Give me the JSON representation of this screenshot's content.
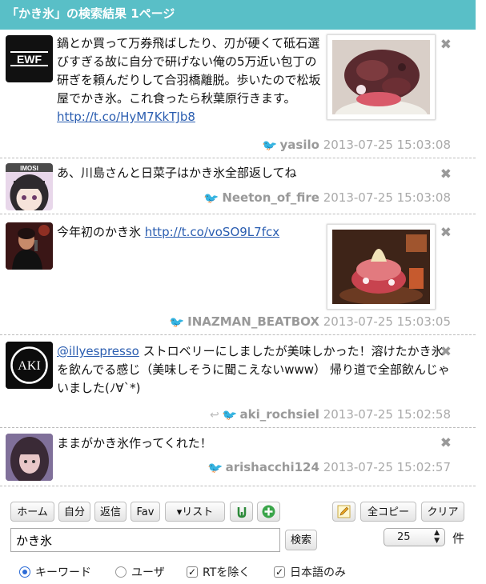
{
  "header": {
    "title": "「かき氷」の検索結果 1ページ"
  },
  "tweets": [
    {
      "text": "鍋とか買って万券飛ばしたり、刃が硬くて砥石選びすぎる故に自分で研げない俺の5万近い包丁の研ぎを頼んだりして合羽橋離脱。歩いたので松坂屋でかき氷。これ食ったら秋葉原行きます。",
      "link": "http://t.co/HyM7KkTJb8",
      "user": "yasilo",
      "time": "2013-07-25 15:03:08",
      "avatar_icon": "ewf-logo-icon"
    },
    {
      "text": "あ、川島さんと日菜子はかき氷全部返してね",
      "user": "Neeton_of_fire",
      "time": "2013-07-25 15:03:08",
      "avatar_icon": "anime-avatar-icon"
    },
    {
      "text": "今年初のかき氷",
      "link": "http://t.co/voSO9L7fcx",
      "user": "INAZMAN_BEATBOX",
      "time": "2013-07-25 15:03:05",
      "avatar_icon": "performer-avatar-icon"
    },
    {
      "mention": "@illyespresso",
      "text": "ストロベリーにしましたが美味しかった！溶けたかき氷を飲んでる感じ（美味しそうに聞こえないwww） 帰り道で全部飲んじゃいました(ﾉ∀`*)",
      "user": "aki_rochsiel",
      "time": "2013-07-25 15:02:58",
      "avatar_icon": "aki-logo-icon"
    },
    {
      "text": "ままがかき氷作ってくれた！",
      "user": "arishacchi124",
      "time": "2013-07-25 15:02:57",
      "avatar_icon": "girl-avatar-icon"
    }
  ],
  "avatar_text": {
    "ewf": "EWF",
    "imosi": "IMOSI",
    "aki": "AKI"
  },
  "close_glyph": "✖",
  "toolbar": {
    "home": "ホーム",
    "self": "自分",
    "reply": "返信",
    "fav": "Fav",
    "list": "▾リスト",
    "copy_all": "全コピー",
    "clear": "クリア",
    "search": "検索",
    "count": "25",
    "count_unit": "件"
  },
  "search": {
    "value": "かき氷"
  },
  "options": {
    "keyword": "キーワード",
    "user": "ユーザ",
    "exclude_rt": "RTを除く",
    "japanese_only": "日本語のみ"
  },
  "colors": {
    "header": "#59bfc7",
    "link": "#2a5db0",
    "twitter": "#3ea7e0"
  }
}
